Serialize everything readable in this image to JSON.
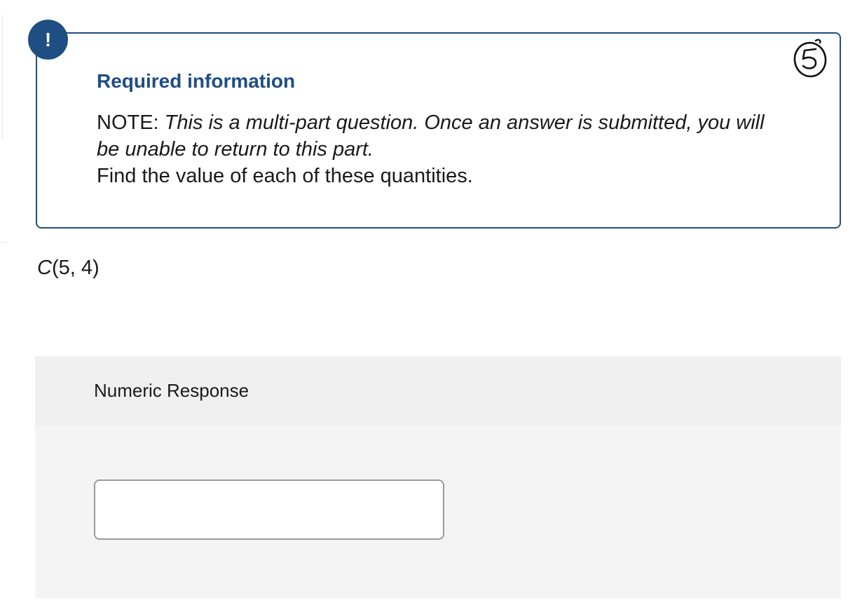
{
  "alert": {
    "symbol": "!"
  },
  "info": {
    "heading": "Required information",
    "note_prefix": "NOTE: ",
    "note_italic": "This is a multi-part question. Once an answer is submitted, you will be unable to return to this part.",
    "instruction": "Find the value of each of these quantities."
  },
  "question": {
    "function_name": "C",
    "arguments": "(5, 4)"
  },
  "response": {
    "label": "Numeric Response",
    "value": ""
  },
  "annotation": {
    "icon": "handwritten-circled-5",
    "text": "5"
  },
  "colors": {
    "accent": "#1f4e82",
    "response_bg": "#f4f4f4",
    "input_border": "#9a9a9a"
  }
}
